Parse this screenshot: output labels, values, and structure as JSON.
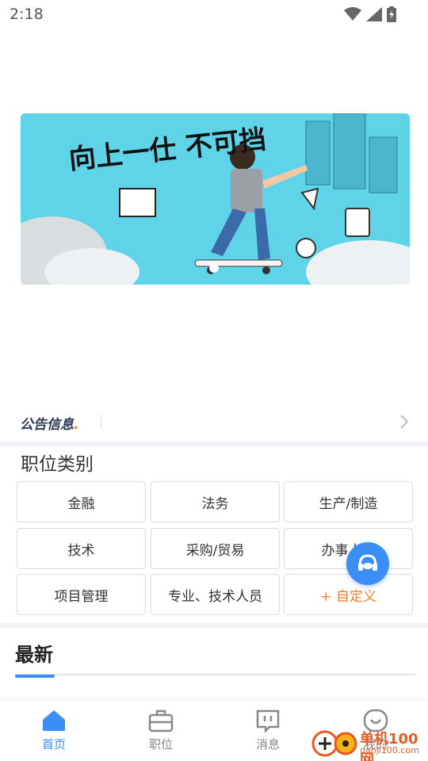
{
  "status_bar": {
    "time": "2:18"
  },
  "banner": {
    "slogan": "向上一仕 不可挡"
  },
  "notice": {
    "logo_text": "公告信息"
  },
  "job_categories": {
    "title": "职位类别",
    "items": [
      "金融",
      "法务",
      "生产/制造",
      "技术",
      "采购/贸易",
      "办事人员",
      "项目管理",
      "专业、技术人员"
    ],
    "custom": "+ 自定义"
  },
  "latest": {
    "title": "最新"
  },
  "tabbar": {
    "items": [
      {
        "label": "首页",
        "icon": "home-icon",
        "active": true
      },
      {
        "label": "职位",
        "icon": "briefcase-icon",
        "active": false
      },
      {
        "label": "消息",
        "icon": "message-icon",
        "active": false
      },
      {
        "label": "我的",
        "icon": "profile-icon",
        "active": false
      }
    ]
  },
  "watermark": {
    "text": "单机100网",
    "domain": "danji100.com"
  },
  "colors": {
    "accent": "#3a8ef6",
    "custom": "#ff7a1a",
    "banner_bg": "#5fd3e8"
  }
}
